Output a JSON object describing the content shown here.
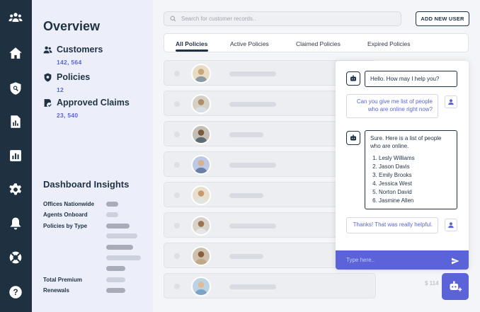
{
  "rail": {
    "icons": [
      "users-group-icon",
      "home-icon",
      "shield-search-icon",
      "document-chart-icon",
      "bar-chart-icon",
      "gear-icon",
      "bell-icon",
      "lifebuoy-icon",
      "help-icon"
    ]
  },
  "overview": {
    "title": "Overview",
    "customers": {
      "label": "Customers",
      "value": "142, 564"
    },
    "policies": {
      "label": "Policies",
      "value": "12"
    },
    "claims": {
      "label": "Approved Claims",
      "value": "23, 540"
    }
  },
  "insights": {
    "title": "Dashboard Insights",
    "offices_label": "Offices Nationwide",
    "agents_label": "Agents Onboard",
    "policy_type_label": "Policies by Type",
    "total_premium_label": "Total Premium",
    "renewals_label": "Renewals"
  },
  "search": {
    "placeholder": "Search for customer records.."
  },
  "toolbar": {
    "add_user_label": "ADD NEW USER"
  },
  "tabs": [
    {
      "label": "All Policies",
      "active": true
    },
    {
      "label": "Active Policies",
      "active": false
    },
    {
      "label": "Claimed Policies",
      "active": false
    },
    {
      "label": "Expired Policies",
      "active": false
    }
  ],
  "table": {
    "amount_partial": "$ 114"
  },
  "chat": {
    "greeting": "Hello. How may I help you?",
    "user_question": "Can you give me list of people who are online right now?",
    "bot_answer_intro": "Sure. Here is a list of people who are online.",
    "online_people": [
      "Lesly Williams",
      "Jason Davis",
      "Emily Brooks",
      "Jessica West",
      "Norton David",
      "Jasmine Allen"
    ],
    "user_thanks": "Thanks! That was really helpful.",
    "input_placeholder": "Type here.."
  },
  "colors": {
    "rail": "#1f3140",
    "accent": "#5a63d8",
    "panel": "#eceffa",
    "dark_text": "#1e3244"
  }
}
